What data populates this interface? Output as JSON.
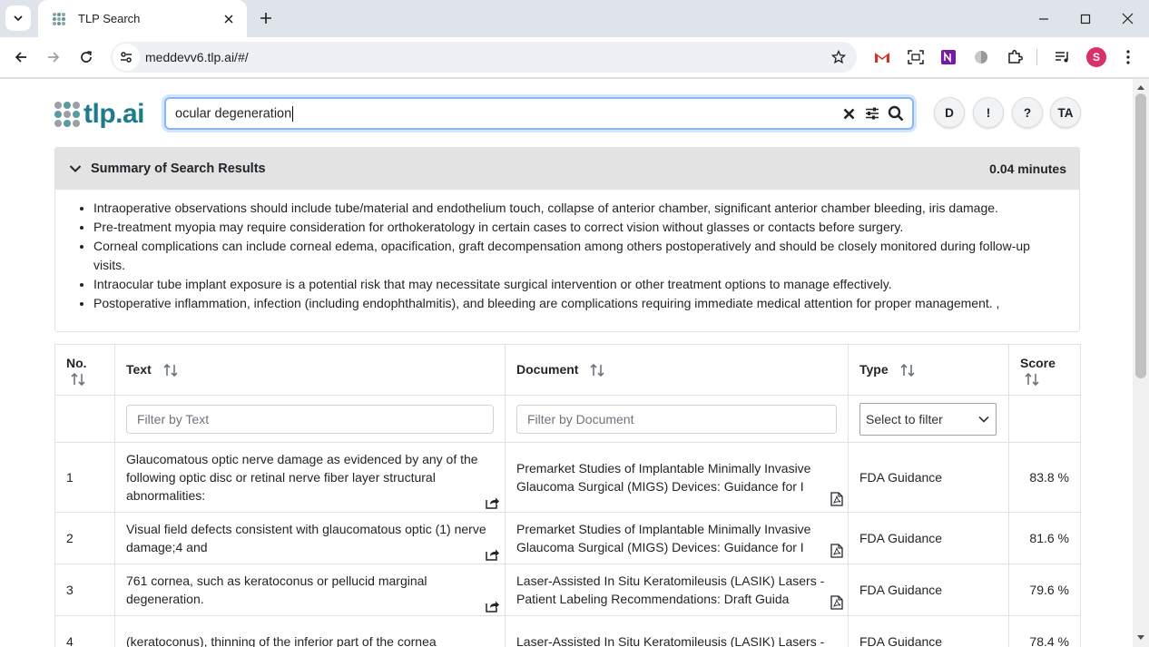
{
  "browser": {
    "tab_title": "TLP Search",
    "url": "meddevv6.tlp.ai/#/",
    "profile_initial": "S"
  },
  "app": {
    "logo_text": "tlp.ai",
    "search": {
      "value": "ocular degeneration"
    },
    "header_buttons": [
      "D",
      "!",
      "?",
      "TA"
    ]
  },
  "summary": {
    "title": "Summary of Search Results",
    "time": "0.04 minutes",
    "bullets": [
      "Intraoperative observations should include tube/material and endothelium touch, collapse of anterior chamber, significant anterior chamber bleeding, iris damage.",
      "Pre-treatment myopia may require consideration for orthokeratology in certain cases to correct vision without glasses or contacts before surgery.",
      "Corneal complications can include corneal edema, opacification, graft decompensation among others postoperatively and should be closely monitored during follow-up visits.",
      "Intraocular tube implant exposure is a potential risk that may necessitate surgical intervention or other treatment options to manage effectively.",
      "Postoperative inflammation, infection (including endophthalmitis), and bleeding are complications requiring immediate medical attention for proper management. ,"
    ]
  },
  "table": {
    "columns": {
      "no": "No.",
      "text": "Text",
      "document": "Document",
      "type": "Type",
      "score": "Score"
    },
    "filters": {
      "text_placeholder": "Filter by Text",
      "document_placeholder": "Filter by Document",
      "type_select": "Select to filter"
    },
    "rows": [
      {
        "no": "1",
        "text": " Glaucomatous optic nerve damage as evidenced by any of the following optic disc or retinal nerve fiber layer structural abnormalities:",
        "document": " Premarket Studies of Implantable Minimally Invasive Glaucoma Surgical (MIGS) Devices: Guidance for I",
        "type": "FDA Guidance",
        "score": "83.8 %"
      },
      {
        "no": "2",
        "text": " Visual field defects consistent with glaucomatous optic (1) nerve damage;4 and",
        "document": " Premarket Studies of Implantable Minimally Invasive Glaucoma Surgical (MIGS) Devices: Guidance for I",
        "type": "FDA Guidance",
        "score": "81.6 %"
      },
      {
        "no": "3",
        "text": " 761 cornea, such as keratoconus or pellucid marginal degeneration.",
        "document": " Laser-Assisted In Situ Keratomileusis (LASIK) Lasers - Patient Labeling Recommendations: Draft Guida",
        "type": "FDA Guidance",
        "score": "79.6 %"
      },
      {
        "no": "4",
        "text": " (keratoconus), thinning of the inferior part of the cornea",
        "document": " Laser-Assisted In Situ Keratomileusis (LASIK) Lasers -",
        "type": "FDA Guidance",
        "score": "78.4 %"
      }
    ]
  }
}
